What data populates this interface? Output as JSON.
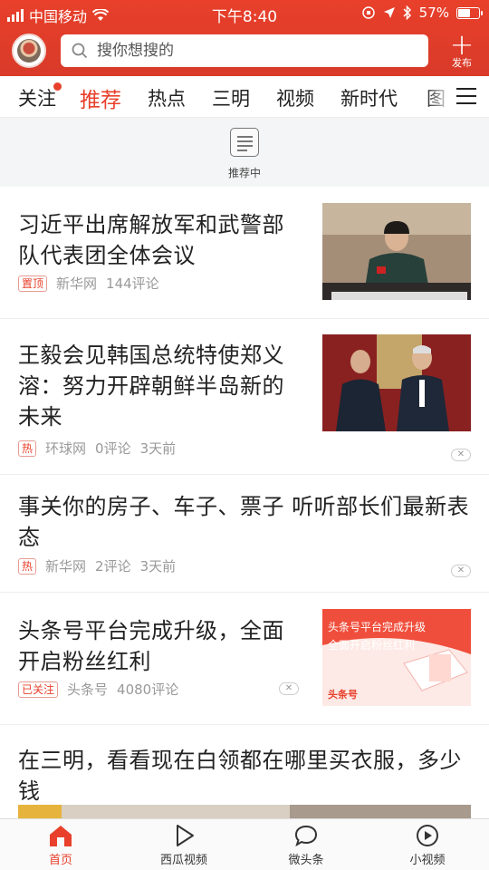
{
  "status_bar": {
    "carrier": "中国移动",
    "time": "下午8:40",
    "battery": "57%",
    "battery_level": 0.57
  },
  "header": {
    "search_placeholder": "搜你想搜的",
    "publish_label": "发布",
    "brand_color": "#e8402b"
  },
  "tabs": [
    {
      "label": "关注",
      "has_dot": true
    },
    {
      "label": "推荐",
      "active": true
    },
    {
      "label": "热点"
    },
    {
      "label": "三明"
    },
    {
      "label": "视频"
    },
    {
      "label": "新时代"
    },
    {
      "label": "图"
    }
  ],
  "refresh": {
    "label": "推荐中"
  },
  "feed": [
    {
      "title": "习近平出席解放军和武警部队代表团全体会议",
      "badge": "置顶",
      "source": "新华网",
      "comments": "144评论",
      "time": "",
      "has_thumb": true
    },
    {
      "title": "王毅会见韩国总统特使郑义溶：努力开辟朝鲜半岛新的未来",
      "badge": "热",
      "source": "环球网",
      "comments": "0评论",
      "time": "3天前",
      "has_thumb": true
    },
    {
      "title": "事关你的房子、车子、票子 听听部长们最新表态",
      "badge": "热",
      "source": "新华网",
      "comments": "2评论",
      "time": "3天前",
      "has_thumb": false
    },
    {
      "title": "头条号平台完成升级，全面开启粉丝红利",
      "badge": "已关注",
      "source": "头条号",
      "comments": "4080评论",
      "time": "",
      "has_thumb": true,
      "thumb_text_1": "头条号平台完成升级",
      "thumb_text_2": "全面开启粉丝红利",
      "thumb_brand": "头条号"
    },
    {
      "title": "在三明，看看现在白领都在哪里买衣服，多少钱",
      "has_thumb": false
    }
  ],
  "bottom_nav": [
    {
      "label": "首页",
      "icon": "home-icon",
      "active": true
    },
    {
      "label": "西瓜视频",
      "icon": "play-icon"
    },
    {
      "label": "微头条",
      "icon": "chat-bubble-icon"
    },
    {
      "label": "小视频",
      "icon": "small-video-icon"
    }
  ]
}
